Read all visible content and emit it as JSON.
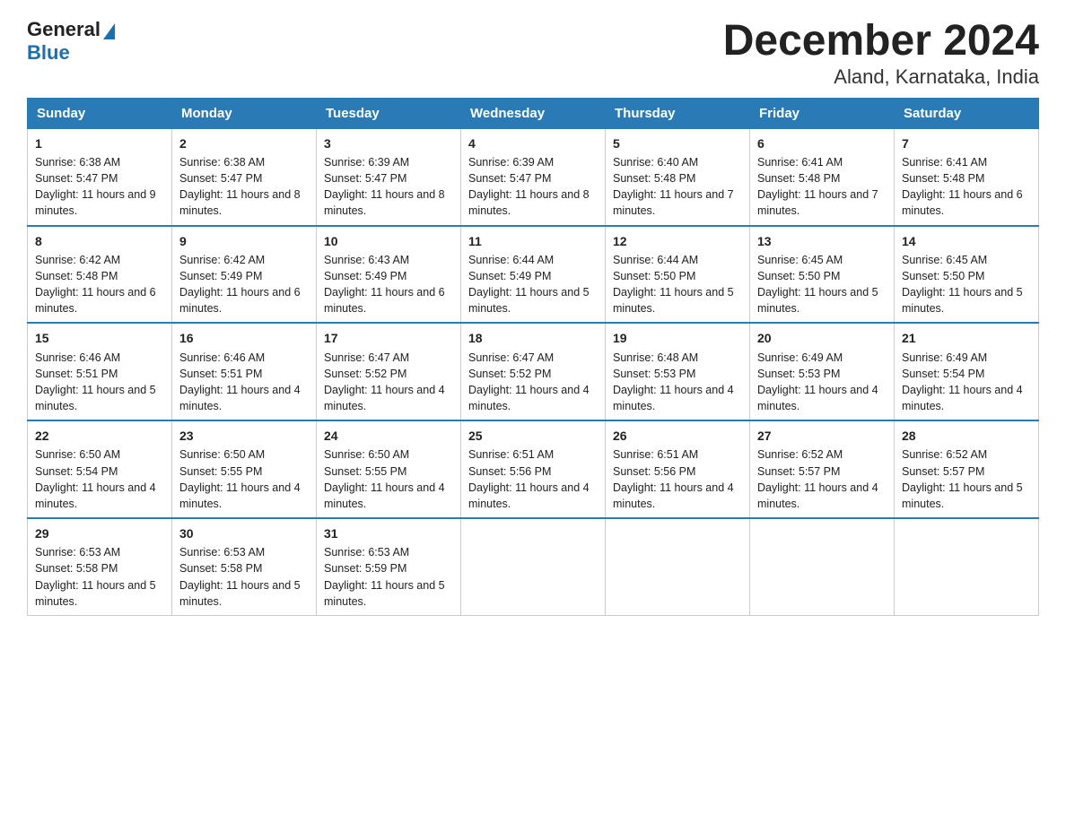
{
  "logo": {
    "text_general": "General",
    "text_blue": "Blue",
    "triangle_decoration": "▶"
  },
  "title": "December 2024",
  "subtitle": "Aland, Karnataka, India",
  "days_of_week": [
    "Sunday",
    "Monday",
    "Tuesday",
    "Wednesday",
    "Thursday",
    "Friday",
    "Saturday"
  ],
  "weeks": [
    [
      {
        "day": 1,
        "sunrise": "6:38 AM",
        "sunset": "5:47 PM",
        "daylight": "11 hours and 9 minutes."
      },
      {
        "day": 2,
        "sunrise": "6:38 AM",
        "sunset": "5:47 PM",
        "daylight": "11 hours and 8 minutes."
      },
      {
        "day": 3,
        "sunrise": "6:39 AM",
        "sunset": "5:47 PM",
        "daylight": "11 hours and 8 minutes."
      },
      {
        "day": 4,
        "sunrise": "6:39 AM",
        "sunset": "5:47 PM",
        "daylight": "11 hours and 8 minutes."
      },
      {
        "day": 5,
        "sunrise": "6:40 AM",
        "sunset": "5:48 PM",
        "daylight": "11 hours and 7 minutes."
      },
      {
        "day": 6,
        "sunrise": "6:41 AM",
        "sunset": "5:48 PM",
        "daylight": "11 hours and 7 minutes."
      },
      {
        "day": 7,
        "sunrise": "6:41 AM",
        "sunset": "5:48 PM",
        "daylight": "11 hours and 6 minutes."
      }
    ],
    [
      {
        "day": 8,
        "sunrise": "6:42 AM",
        "sunset": "5:48 PM",
        "daylight": "11 hours and 6 minutes."
      },
      {
        "day": 9,
        "sunrise": "6:42 AM",
        "sunset": "5:49 PM",
        "daylight": "11 hours and 6 minutes."
      },
      {
        "day": 10,
        "sunrise": "6:43 AM",
        "sunset": "5:49 PM",
        "daylight": "11 hours and 6 minutes."
      },
      {
        "day": 11,
        "sunrise": "6:44 AM",
        "sunset": "5:49 PM",
        "daylight": "11 hours and 5 minutes."
      },
      {
        "day": 12,
        "sunrise": "6:44 AM",
        "sunset": "5:50 PM",
        "daylight": "11 hours and 5 minutes."
      },
      {
        "day": 13,
        "sunrise": "6:45 AM",
        "sunset": "5:50 PM",
        "daylight": "11 hours and 5 minutes."
      },
      {
        "day": 14,
        "sunrise": "6:45 AM",
        "sunset": "5:50 PM",
        "daylight": "11 hours and 5 minutes."
      }
    ],
    [
      {
        "day": 15,
        "sunrise": "6:46 AM",
        "sunset": "5:51 PM",
        "daylight": "11 hours and 5 minutes."
      },
      {
        "day": 16,
        "sunrise": "6:46 AM",
        "sunset": "5:51 PM",
        "daylight": "11 hours and 4 minutes."
      },
      {
        "day": 17,
        "sunrise": "6:47 AM",
        "sunset": "5:52 PM",
        "daylight": "11 hours and 4 minutes."
      },
      {
        "day": 18,
        "sunrise": "6:47 AM",
        "sunset": "5:52 PM",
        "daylight": "11 hours and 4 minutes."
      },
      {
        "day": 19,
        "sunrise": "6:48 AM",
        "sunset": "5:53 PM",
        "daylight": "11 hours and 4 minutes."
      },
      {
        "day": 20,
        "sunrise": "6:49 AM",
        "sunset": "5:53 PM",
        "daylight": "11 hours and 4 minutes."
      },
      {
        "day": 21,
        "sunrise": "6:49 AM",
        "sunset": "5:54 PM",
        "daylight": "11 hours and 4 minutes."
      }
    ],
    [
      {
        "day": 22,
        "sunrise": "6:50 AM",
        "sunset": "5:54 PM",
        "daylight": "11 hours and 4 minutes."
      },
      {
        "day": 23,
        "sunrise": "6:50 AM",
        "sunset": "5:55 PM",
        "daylight": "11 hours and 4 minutes."
      },
      {
        "day": 24,
        "sunrise": "6:50 AM",
        "sunset": "5:55 PM",
        "daylight": "11 hours and 4 minutes."
      },
      {
        "day": 25,
        "sunrise": "6:51 AM",
        "sunset": "5:56 PM",
        "daylight": "11 hours and 4 minutes."
      },
      {
        "day": 26,
        "sunrise": "6:51 AM",
        "sunset": "5:56 PM",
        "daylight": "11 hours and 4 minutes."
      },
      {
        "day": 27,
        "sunrise": "6:52 AM",
        "sunset": "5:57 PM",
        "daylight": "11 hours and 4 minutes."
      },
      {
        "day": 28,
        "sunrise": "6:52 AM",
        "sunset": "5:57 PM",
        "daylight": "11 hours and 5 minutes."
      }
    ],
    [
      {
        "day": 29,
        "sunrise": "6:53 AM",
        "sunset": "5:58 PM",
        "daylight": "11 hours and 5 minutes."
      },
      {
        "day": 30,
        "sunrise": "6:53 AM",
        "sunset": "5:58 PM",
        "daylight": "11 hours and 5 minutes."
      },
      {
        "day": 31,
        "sunrise": "6:53 AM",
        "sunset": "5:59 PM",
        "daylight": "11 hours and 5 minutes."
      },
      null,
      null,
      null,
      null
    ]
  ]
}
